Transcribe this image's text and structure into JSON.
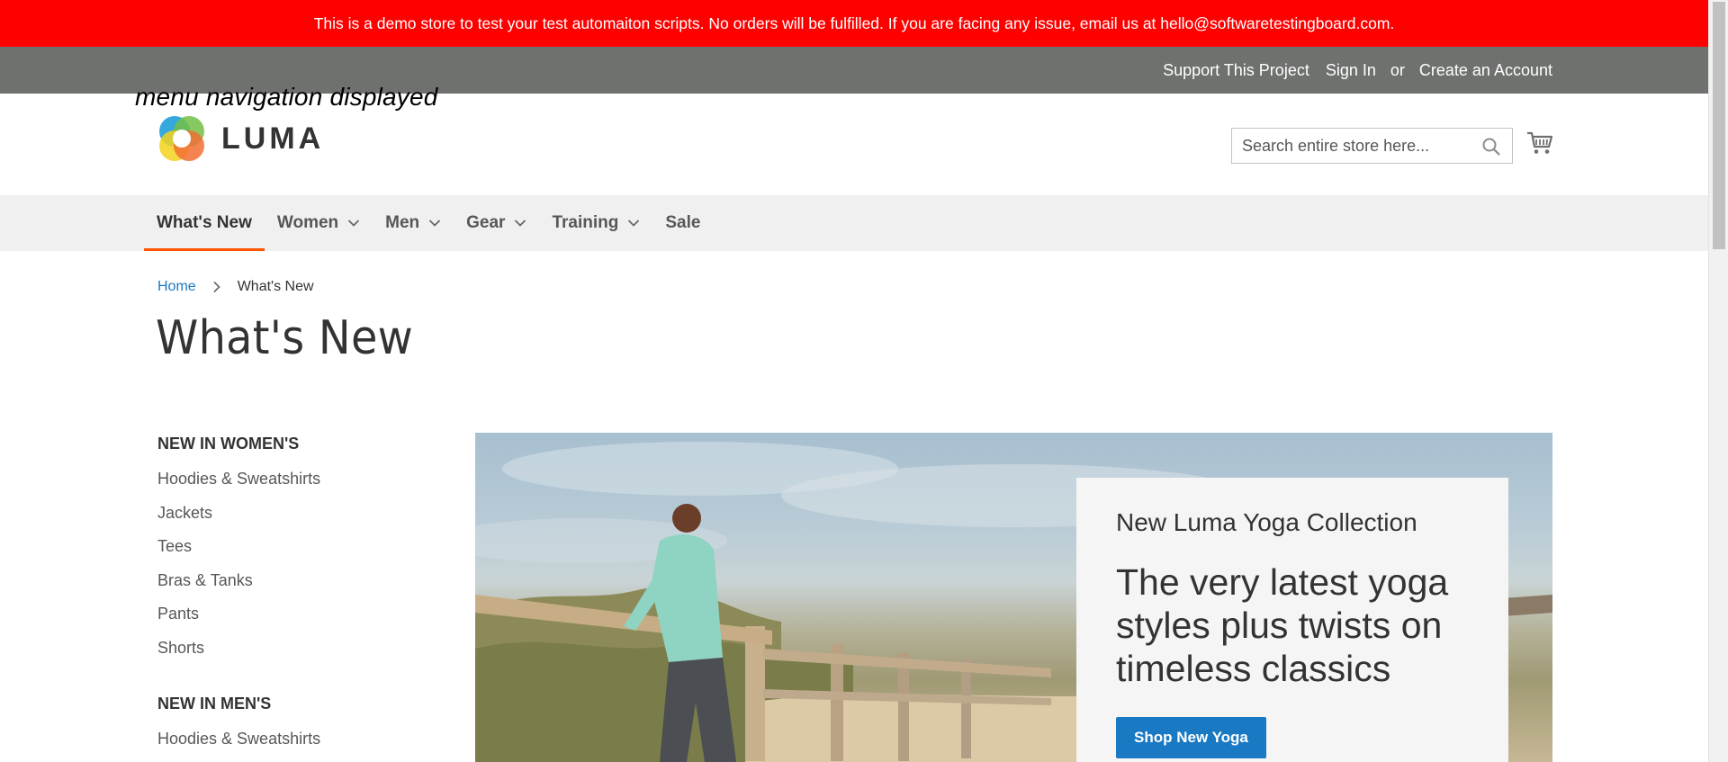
{
  "banner": {
    "text": "This is a demo store to test your test automaiton scripts. No orders will be fulfilled. If you are facing any issue, email us at hello@softwaretestingboard.com."
  },
  "top_links": {
    "support": "Support This Project",
    "sign_in": "Sign In",
    "or": "or",
    "create_account": "Create an Account"
  },
  "overlay_caption": "menu navigation displayed",
  "logo": {
    "text": "LUMA"
  },
  "search": {
    "placeholder": "Search entire store here..."
  },
  "nav": {
    "items": [
      {
        "label": "What's New",
        "active": true,
        "has_dropdown": false
      },
      {
        "label": "Women",
        "active": false,
        "has_dropdown": true
      },
      {
        "label": "Men",
        "active": false,
        "has_dropdown": true
      },
      {
        "label": "Gear",
        "active": false,
        "has_dropdown": true
      },
      {
        "label": "Training",
        "active": false,
        "has_dropdown": true
      },
      {
        "label": "Sale",
        "active": false,
        "has_dropdown": false
      }
    ]
  },
  "breadcrumb": {
    "home": "Home",
    "current": "What's New"
  },
  "page_title": "What's New",
  "sidebar": {
    "women": {
      "title": "NEW IN WOMEN'S",
      "items": [
        "Hoodies & Sweatshirts",
        "Jackets",
        "Tees",
        "Bras & Tanks",
        "Pants",
        "Shorts"
      ]
    },
    "men": {
      "title": "NEW IN MEN'S",
      "items": [
        "Hoodies & Sweatshirts"
      ]
    }
  },
  "promo": {
    "kicker": "New Luma Yoga Collection",
    "headline": "The very latest yoga styles plus twists on timeless classics",
    "button": "Shop New Yoga"
  },
  "colors": {
    "banner": "#ff0000",
    "top_bar": "#6e716e",
    "nav_bg": "#f0f0f0",
    "active_underline": "#ff5501",
    "link": "#1979c3",
    "button": "#1979c3"
  }
}
